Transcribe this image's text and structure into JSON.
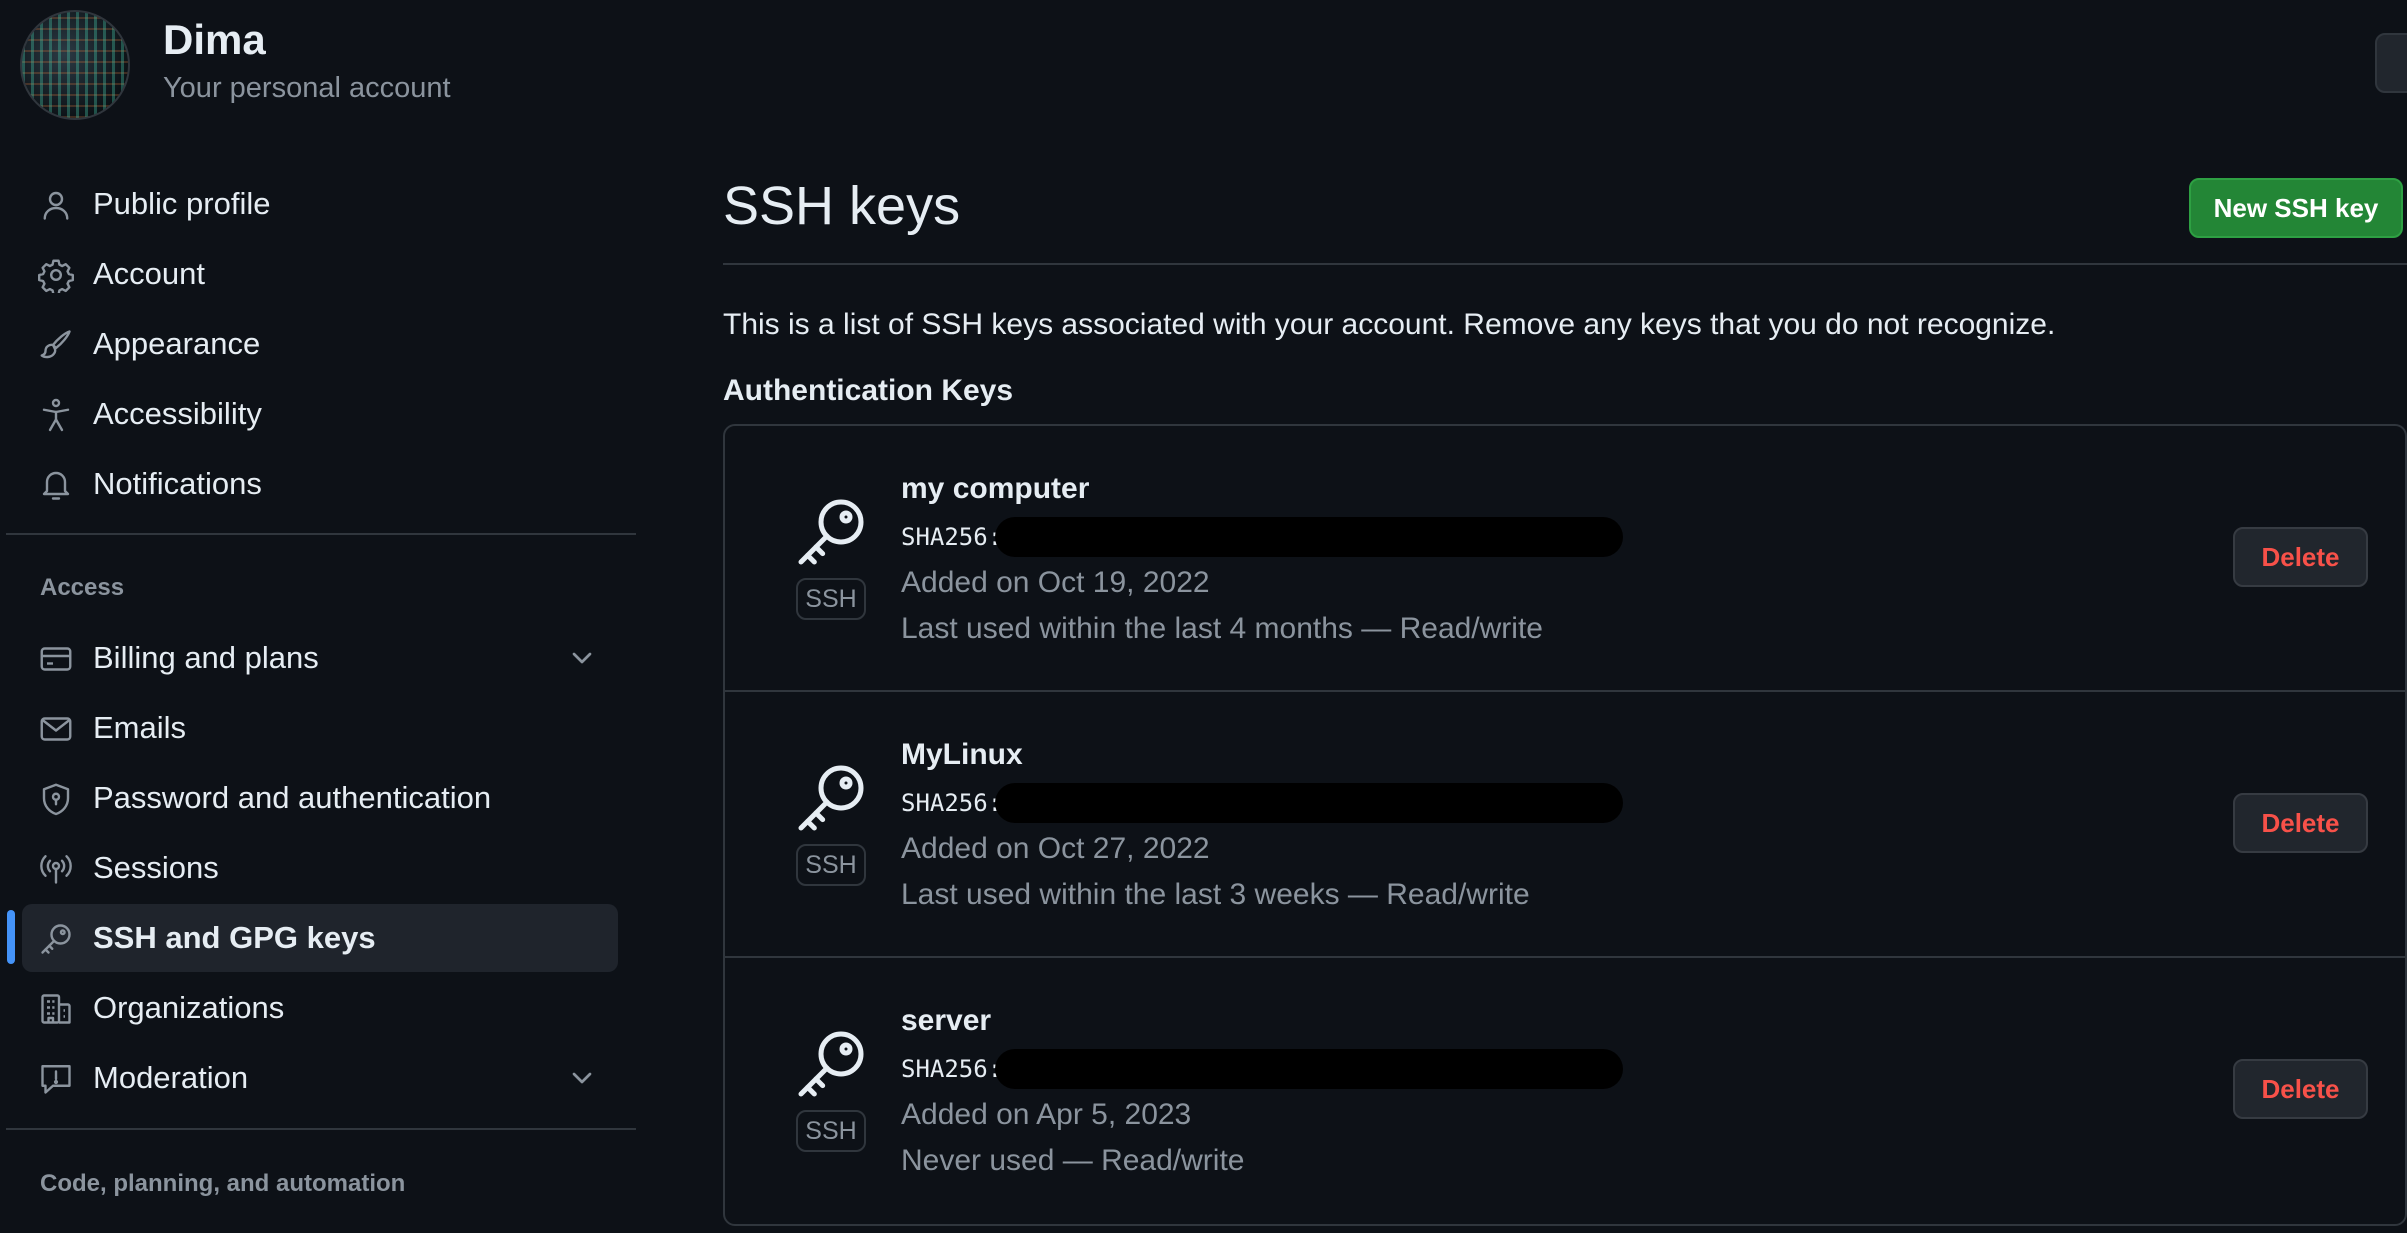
{
  "header": {
    "user_name": "Dima",
    "account_subtitle": "Your personal account"
  },
  "sidebar": {
    "items": [
      {
        "label": "Public profile",
        "icon": "person-icon"
      },
      {
        "label": "Account",
        "icon": "gear-icon"
      },
      {
        "label": "Appearance",
        "icon": "paintbrush-icon"
      },
      {
        "label": "Accessibility",
        "icon": "accessibility-icon"
      },
      {
        "label": "Notifications",
        "icon": "bell-icon"
      }
    ],
    "access_heading": "Access",
    "access_items": [
      {
        "label": "Billing and plans",
        "icon": "credit-card-icon",
        "expandable": true
      },
      {
        "label": "Emails",
        "icon": "mail-icon"
      },
      {
        "label": "Password and authentication",
        "icon": "shield-lock-icon"
      },
      {
        "label": "Sessions",
        "icon": "broadcast-icon"
      },
      {
        "label": "SSH and GPG keys",
        "icon": "key-icon",
        "active": true
      },
      {
        "label": "Organizations",
        "icon": "organization-icon"
      },
      {
        "label": "Moderation",
        "icon": "report-icon",
        "expandable": true
      }
    ],
    "code_heading": "Code, planning, and automation"
  },
  "main": {
    "title": "SSH keys",
    "new_key_button": "New SSH key",
    "description": "This is a list of SSH keys associated with your account. Remove any keys that you do not recognize.",
    "section_title": "Authentication Keys",
    "keys": [
      {
        "name": "my computer",
        "fingerprint_label": "SHA256:",
        "added": "Added on Oct 19, 2022",
        "last_used": "Last used within the last 4 months — Read/write",
        "badge": "SSH",
        "delete_label": "Delete"
      },
      {
        "name": "MyLinux",
        "fingerprint_label": "SHA256:",
        "added": "Added on Oct 27, 2022",
        "last_used": "Last used within the last 3 weeks — Read/write",
        "badge": "SSH",
        "delete_label": "Delete"
      },
      {
        "name": "server",
        "fingerprint_label": "SHA256:",
        "added": "Added on Apr 5, 2023",
        "last_used": "Never used — Read/write",
        "badge": "SSH",
        "delete_label": "Delete"
      }
    ]
  },
  "colors": {
    "background": "#0d1117",
    "accent": "#4493f8",
    "primary_button": "#238636",
    "danger_text": "#f85149",
    "muted_text": "#8b949e"
  }
}
